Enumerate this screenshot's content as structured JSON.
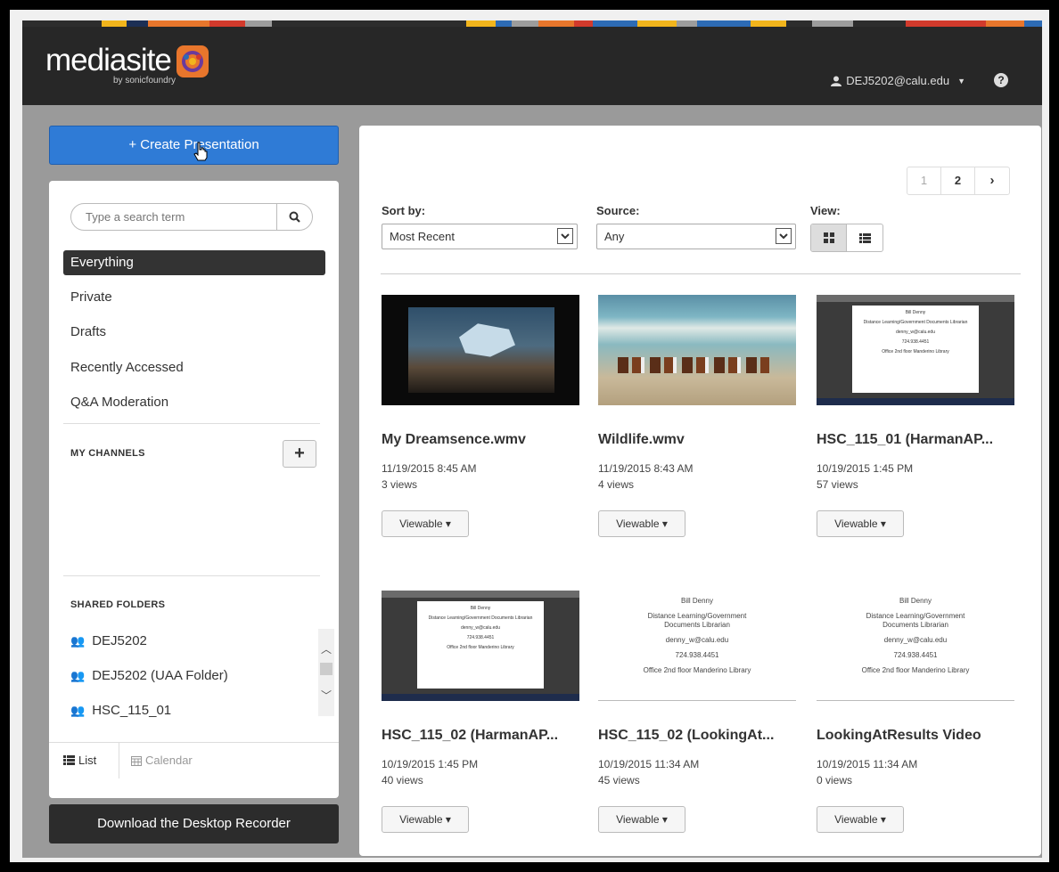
{
  "header": {
    "logo_text": "mediasite",
    "logo_sub": "by sonicfoundry",
    "user": "DEJ5202@calu.edu",
    "help": "?"
  },
  "colors": {
    "primary": "#2f7bd6",
    "header": "#272727",
    "active_nav": "#333333",
    "stripes": [
      "#f2b51c",
      "#2d6bb5",
      "#e8762c",
      "#9c9c9c",
      "#d23a2c"
    ]
  },
  "sidebar": {
    "create_label": "+ Create Presentation",
    "search_placeholder": "Type a search term",
    "nav": [
      "Everything",
      "Private",
      "Drafts",
      "Recently Accessed",
      "Q&A Moderation"
    ],
    "my_channels": "MY CHANNELS",
    "shared_folders": "SHARED FOLDERS",
    "folders": [
      "DEJ5202",
      "DEJ5202 (UAA Folder)",
      "HSC_115_01"
    ],
    "view_list": "List",
    "view_calendar": "Calendar",
    "download_label": "Download the Desktop Recorder"
  },
  "main": {
    "pages": [
      "1",
      "2",
      "›"
    ],
    "sort_label": "Sort by:",
    "sort_value": "Most Recent",
    "source_label": "Source:",
    "source_value": "Any",
    "view_label": "View:",
    "presentations": [
      {
        "title": "My Dreamsence.wmv",
        "date": "11/19/2015 8:45 AM",
        "views": "3 views",
        "status": "Viewable ▾",
        "thumb": "dream"
      },
      {
        "title": "Wildlife.wmv",
        "date": "11/19/2015 8:43 AM",
        "views": "4 views",
        "status": "Viewable ▾",
        "thumb": "wildlife"
      },
      {
        "title": "HSC_115_01 (HarmanAP...",
        "date": "10/19/2015 1:45 PM",
        "views": "57 views",
        "status": "Viewable ▾",
        "thumb": "screen"
      },
      {
        "title": "HSC_115_02 (HarmanAP...",
        "date": "10/19/2015 1:45 PM",
        "views": "40 views",
        "status": "Viewable ▾",
        "thumb": "screen"
      },
      {
        "title": "HSC_115_02 (LookingAt...",
        "date": "10/19/2015 11:34 AM",
        "views": "45 views",
        "status": "Viewable ▾",
        "thumb": "doc"
      },
      {
        "title": "LookingAtResults Video",
        "date": "10/19/2015 11:34 AM",
        "views": "0 views",
        "status": "Viewable ▾",
        "thumb": "doc"
      }
    ],
    "doc_slide": {
      "name": "Bill Denny",
      "role": "Distance Learning/Government Documents Librarian",
      "email": "denny_w@calu.edu",
      "phone": "724.938.4451",
      "office": "Office 2nd floor Manderino Library"
    }
  }
}
